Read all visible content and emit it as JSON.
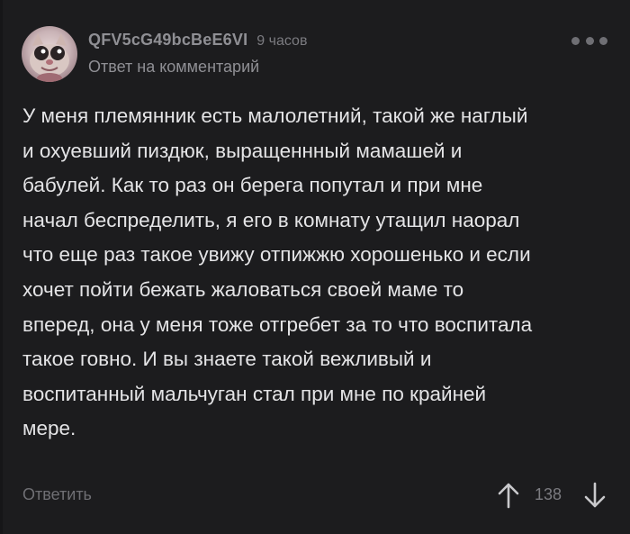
{
  "comment": {
    "author": "QFV5cG49bcBeE6VI",
    "time": "9 часов",
    "reply_label": "Ответ на комментарий",
    "more_icon": "more-dots-icon",
    "avatar_icon": "cat-avatar",
    "lines": [
      "У меня племянник есть малолетний, такой же наглый",
      "и охуевший пиздюк, выращеннный мамашей и",
      "бабулей. Как то раз он берега попутал и при мне",
      "начал беспределить, я его в комнату утащил наорал",
      "что еще раз такое увижу отпижжю хорошенько и если",
      "хочет пойти бежать жаловаться своей маме то",
      "вперед, она у меня тоже отгребет за то что воспитала",
      "такое говно.  И вы знаете такой вежливый и",
      "воспитанный мальчуган стал при мне по крайней",
      "мере."
    ]
  },
  "footer": {
    "reply_button": "Ответить",
    "score": "138",
    "upvote_icon": "arrow-up-icon",
    "downvote_icon": "arrow-down-icon"
  },
  "colors": {
    "background": "#1c1c1e",
    "text": "#e4e4e6",
    "muted": "#8f8f94"
  }
}
